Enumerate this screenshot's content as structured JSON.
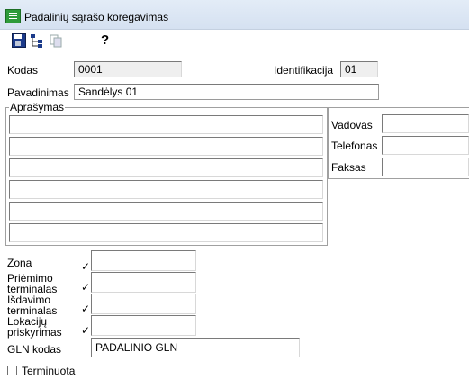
{
  "window": {
    "title": "Padalinių sąrašo koregavimas"
  },
  "toolbar": {
    "icons": [
      "save-icon",
      "tree-icon",
      "copy-icon",
      "help-icon"
    ]
  },
  "form": {
    "kodas_label": "Kodas",
    "kodas_value": "0001",
    "identifikacija_label": "Identifikacija",
    "identifikacija_value": "01",
    "pavadinimas_label": "Pavadinimas",
    "pavadinimas_value": "Sandėlys 01",
    "aprasymas_label": "Aprašymas",
    "aprasymas_lines": [
      "",
      "",
      "",
      "",
      "",
      ""
    ],
    "vadovas_label": "Vadovas",
    "telefonas_label": "Telefonas",
    "faksas_label": "Faksas",
    "zona_label": "Zona",
    "priemimo_label_1": "Priėmimo",
    "priemimo_label_2": "terminalas",
    "isdavimo_label_1": "Išdavimo",
    "isdavimo_label_2": "terminalas",
    "lokaciju_label_1": "Lokacijų",
    "lokaciju_label_2": "priskyrimas",
    "gln_label": "GLN kodas",
    "gln_value": "PADALINIO GLN",
    "terminuota_label": "Terminuota",
    "check_mark": "✓"
  }
}
